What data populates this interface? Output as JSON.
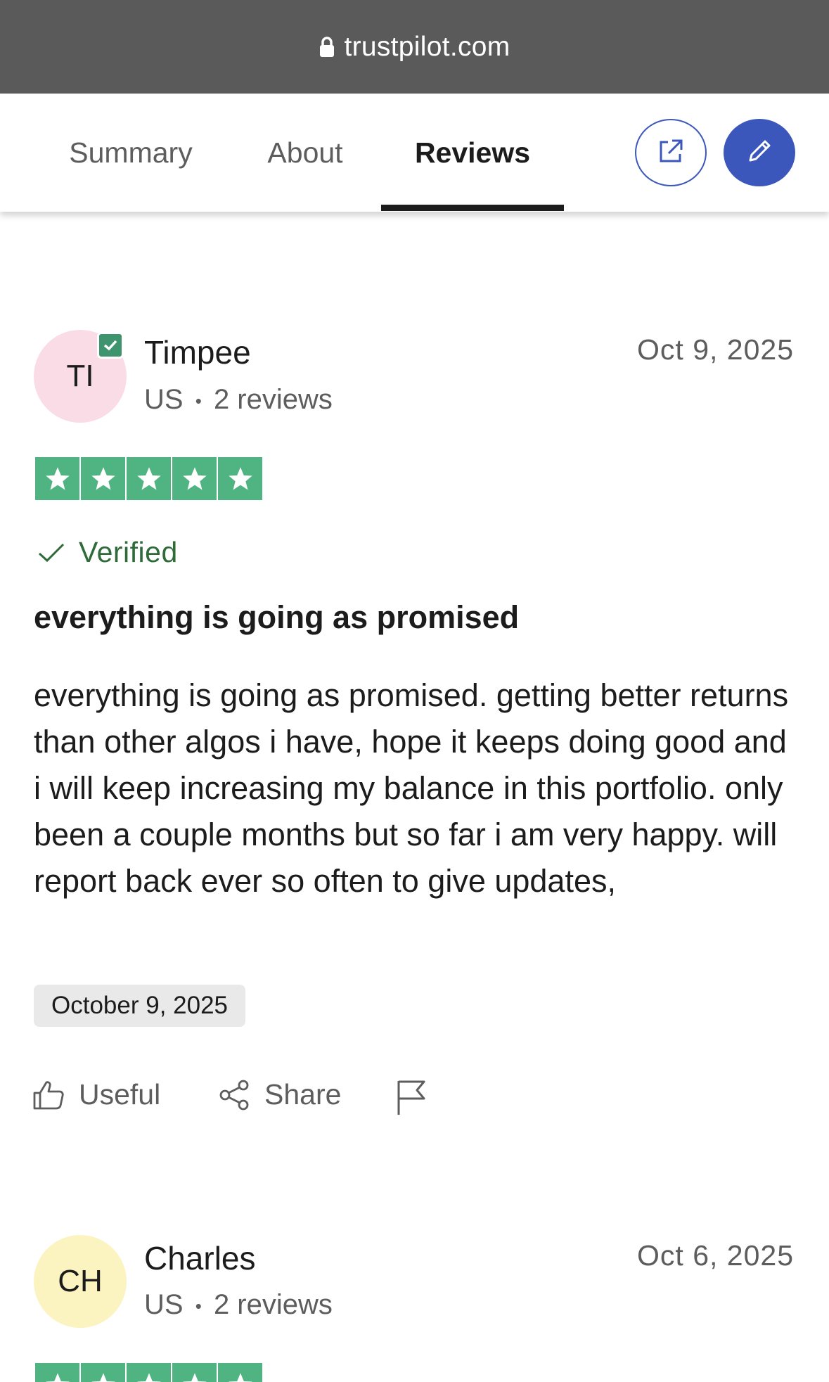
{
  "browser": {
    "url": "trustpilot.com"
  },
  "tabs": [
    {
      "label": "Summary",
      "active": false
    },
    {
      "label": "About",
      "active": false
    },
    {
      "label": "Reviews",
      "active": true
    }
  ],
  "actions": {
    "open_icon": "external-link-icon",
    "write_icon": "pencil-icon"
  },
  "reviews": [
    {
      "initials": "TI",
      "name": "Timpee",
      "country": "US",
      "separator": "•",
      "review_count": "2 reviews",
      "date": "Oct 9, 2025",
      "rating": 5,
      "verified_label": "Verified",
      "title": "everything is going as promised",
      "body": "everything is going as promised. getting better returns than other algos i have, hope it keeps doing good and i will keep increasing my balance in this portfolio. only been a couple months but so far i am very happy. will report back ever so often to give updates,",
      "experience_date": "October 9, 2025",
      "useful_label": "Useful",
      "share_label": "Share",
      "avatar_color": "#f9dce6",
      "has_badge": true
    },
    {
      "initials": "CH",
      "name": "Charles",
      "country": "US",
      "separator": "•",
      "review_count": "2 reviews",
      "date": "Oct 6, 2025",
      "rating": 5,
      "avatar_color": "#fbf3c0",
      "has_badge": false
    }
  ],
  "colors": {
    "star_green": "#4fb481",
    "brand_blue": "#3c57bc",
    "verified_green": "#2e6b39"
  }
}
